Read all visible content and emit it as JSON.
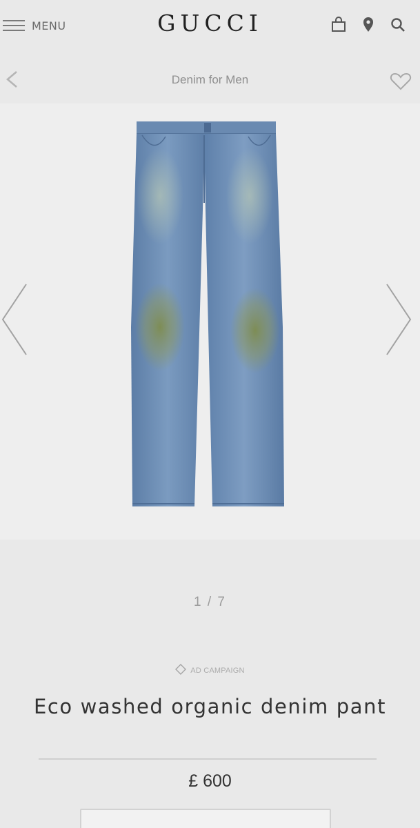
{
  "header": {
    "menu_label": "MENU",
    "logo": "GUCCI",
    "icons": [
      "shopping-bag-icon",
      "location-pin-icon",
      "search-icon"
    ]
  },
  "subheader": {
    "category": "Denim for Men",
    "icons": [
      "back-chevron-icon",
      "heart-icon"
    ]
  },
  "gallery": {
    "counter": "1 / 7",
    "icons": [
      "previous-arrow-icon",
      "next-arrow-icon"
    ]
  },
  "product": {
    "campaign_label": "AD CAMPAIGN",
    "campaign_icon": "diamond-icon",
    "name": "Eco washed organic denim pant",
    "price": "£ 600"
  },
  "colors": {
    "background": "#e9e9e9",
    "gallery_background": "#eeeeee",
    "denim": "#6f8fb4",
    "stain": "#7d8a4e"
  }
}
